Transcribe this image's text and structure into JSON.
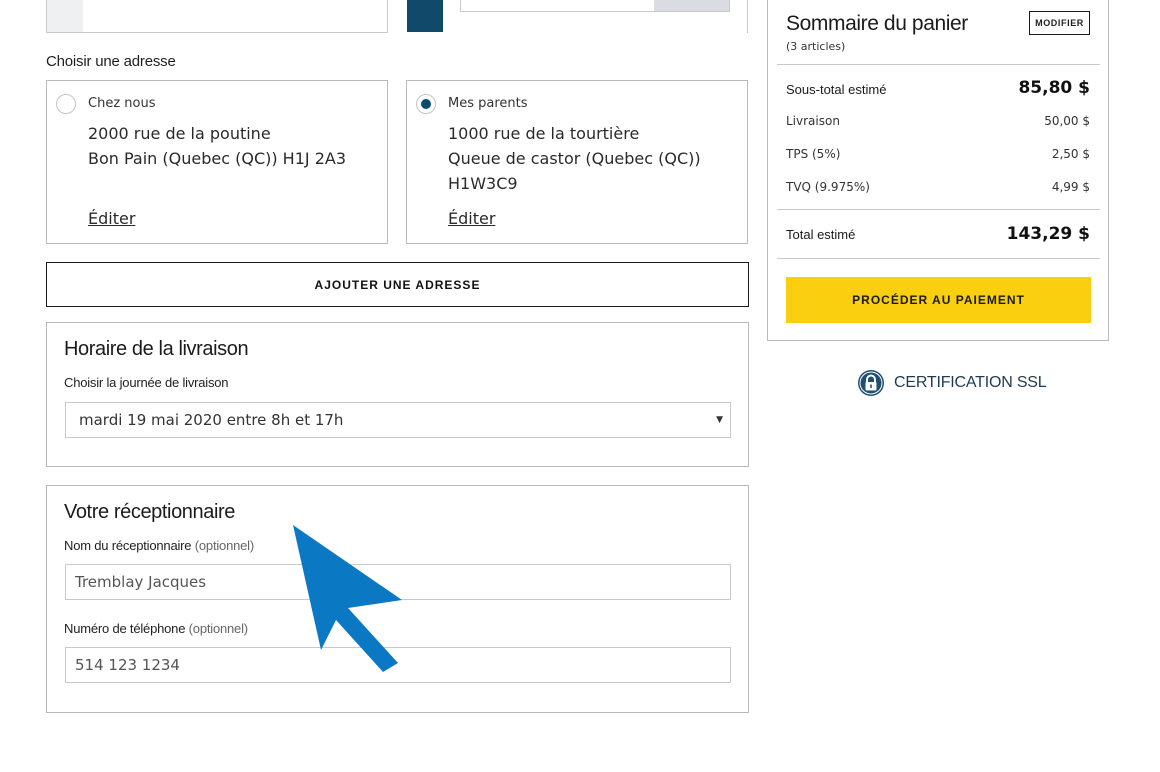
{
  "address_section": {
    "label": "Choisir une adresse",
    "addresses": [
      {
        "name": "Chez nous",
        "line1": "2000 rue de la poutine",
        "line2": "Bon Pain (Quebec (QC)) H1J 2A3",
        "line3": "",
        "edit_label": "Éditer",
        "selected": false
      },
      {
        "name": "Mes parents",
        "line1": "1000 rue de la tourtière",
        "line2": "Queue de castor (Quebec (QC))",
        "line3": "H1W3C9",
        "edit_label": "Éditer",
        "selected": true
      }
    ],
    "add_button": "AJOUTER UNE ADRESSE"
  },
  "delivery_schedule": {
    "title": "Horaire de la livraison",
    "day_label": "Choisir la journée de livraison",
    "selected_day": "mardi 19 mai 2020 entre 8h et 17h"
  },
  "recipient": {
    "title": "Votre réceptionnaire",
    "name_label": "Nom du réceptionnaire",
    "phone_label": "Numéro de téléphone",
    "optional_label": "(optionnel)",
    "name_value": "Tremblay Jacques",
    "phone_value": "514 123 1234"
  },
  "summary": {
    "title": "Sommaire du panier",
    "subtitle": "(3 articles)",
    "modify_button": "MODIFIER",
    "subtotal_label": "Sous-total estimé",
    "subtotal_value": "85,80 $",
    "shipping_label": "Livraison",
    "shipping_value": "50,00 $",
    "tps_label": "TPS (5%)",
    "tps_value": "2,50 $",
    "tvq_label": "TVQ (9.975%)",
    "tvq_value": "4,99 $",
    "total_label": "Total estimé",
    "total_value": "143,29 $",
    "pay_button": "PROCÉDER AU PAIEMENT"
  },
  "ssl": {
    "label": "CERTIFICATION SSL",
    "icon": "padlock-icon"
  },
  "colors": {
    "accent_yellow": "#f9cf0f",
    "navy": "#0f4a6b",
    "cursor_blue": "#0a78c2"
  }
}
